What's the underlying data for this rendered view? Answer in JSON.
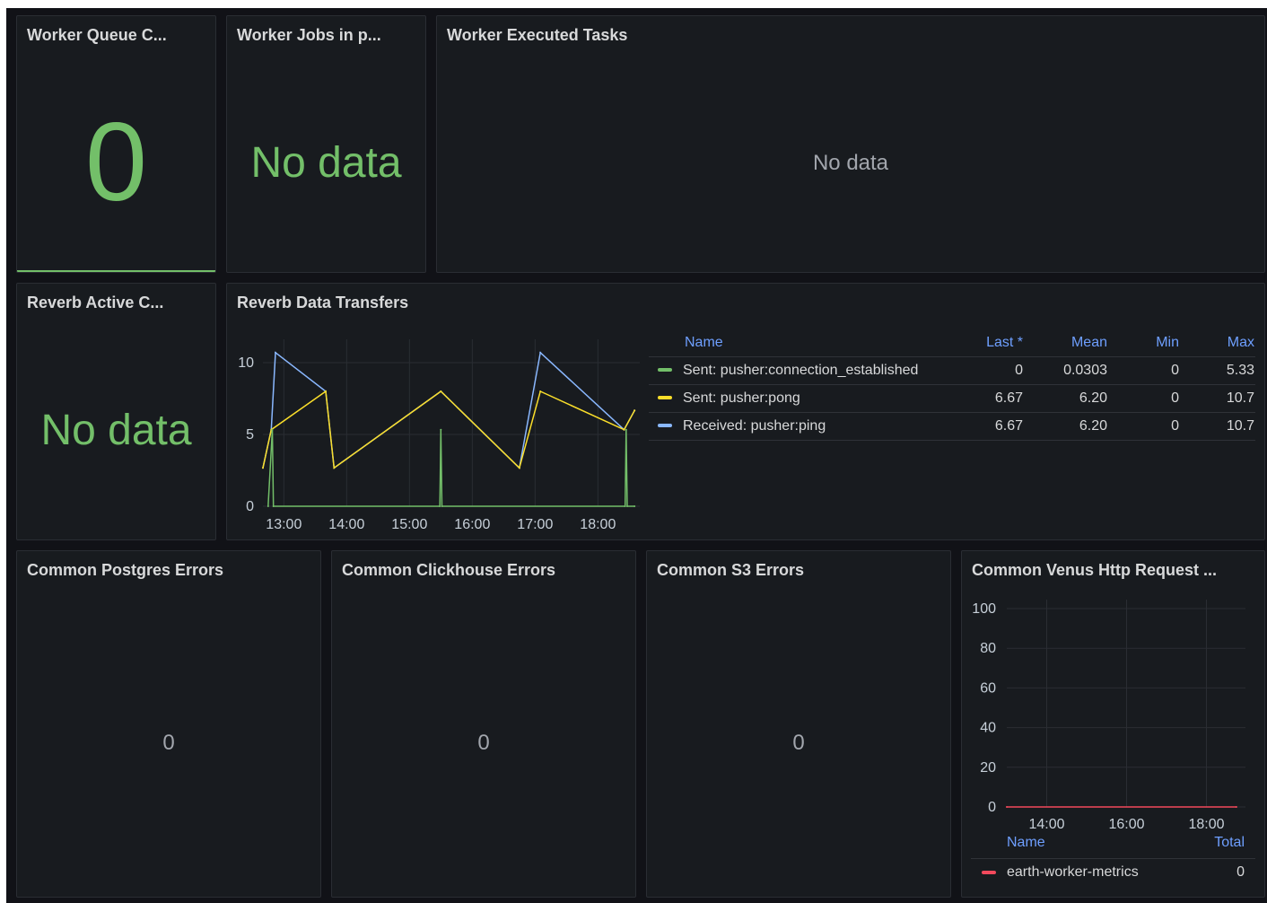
{
  "panels": {
    "worker_queue": {
      "title": "Worker Queue C...",
      "value": "0"
    },
    "worker_jobs": {
      "title": "Worker Jobs in p...",
      "value": "No data"
    },
    "worker_executed": {
      "title": "Worker Executed Tasks",
      "value": "No data"
    },
    "reverb_active": {
      "title": "Reverb Active C...",
      "value": "No data"
    },
    "reverb_transfers": {
      "title": "Reverb Data Transfers",
      "legend": {
        "headers": [
          "Name",
          "Last *",
          "Mean",
          "Min",
          "Max"
        ],
        "rows": [
          {
            "name": "Sent: pusher:connection_established",
            "color": "#73bf69",
            "last": "0",
            "mean": "0.0303",
            "min": "0",
            "max": "5.33"
          },
          {
            "name": "Sent: pusher:pong",
            "color": "#fade2a",
            "last": "6.67",
            "mean": "6.20",
            "min": "0",
            "max": "10.7"
          },
          {
            "name": "Received: pusher:ping",
            "color": "#8ab8ff",
            "last": "6.67",
            "mean": "6.20",
            "min": "0",
            "max": "10.7"
          }
        ]
      }
    },
    "postgres_errors": {
      "title": "Common Postgres Errors",
      "value": "0"
    },
    "clickhouse_errors": {
      "title": "Common Clickhouse Errors",
      "value": "0"
    },
    "s3_errors": {
      "title": "Common S3 Errors",
      "value": "0"
    },
    "venus_http": {
      "title": "Common Venus Http Request ...",
      "legend": {
        "name_header": "Name",
        "total_header": "Total",
        "row": {
          "name": "earth-worker-metrics",
          "color": "#f2495c",
          "total": "0"
        }
      }
    }
  },
  "chart_data": [
    {
      "type": "line",
      "xlabel": "",
      "ylabel": "",
      "x_ticks": [
        "13:00",
        "14:00",
        "15:00",
        "16:00",
        "17:00",
        "18:00"
      ],
      "y_ticks": [
        "0",
        "5",
        "10"
      ],
      "ylim": [
        0,
        11
      ],
      "grid": true,
      "legend_placement": "right",
      "series": [
        {
          "name": "Sent: pusher:connection_established",
          "color": "#73bf69",
          "points": [
            [
              "12:45",
              0
            ],
            [
              "12:49",
              5.33
            ],
            [
              "12:50",
              0
            ],
            [
              "15:29",
              0
            ],
            [
              "15:30",
              5.33
            ],
            [
              "15:31",
              0
            ],
            [
              "18:26",
              0
            ],
            [
              "18:27",
              5.33
            ],
            [
              "18:28",
              0
            ],
            [
              "18:35",
              0
            ]
          ]
        },
        {
          "name": "Sent: pusher:pong",
          "color": "#fade2a",
          "points": [
            [
              "12:40",
              2.67
            ],
            [
              "12:48",
              5.33
            ],
            [
              "13:40",
              8
            ],
            [
              "13:48",
              2.67
            ],
            [
              "15:30",
              8
            ],
            [
              "16:45",
              2.67
            ],
            [
              "17:05",
              8
            ],
            [
              "18:25",
              5.33
            ],
            [
              "18:35",
              6.67
            ]
          ]
        },
        {
          "name": "Received: pusher:ping",
          "color": "#8ab8ff",
          "points": [
            [
              "12:40",
              2.67
            ],
            [
              "12:48",
              5.33
            ],
            [
              "12:52",
              10.7
            ],
            [
              "13:40",
              8
            ],
            [
              "13:48",
              2.67
            ],
            [
              "15:30",
              8
            ],
            [
              "16:45",
              2.67
            ],
            [
              "17:05",
              10.7
            ],
            [
              "18:25",
              5.33
            ],
            [
              "18:35",
              6.67
            ]
          ]
        }
      ]
    },
    {
      "type": "line",
      "xlabel": "",
      "ylabel": "",
      "x_ticks": [
        "14:00",
        "16:00",
        "18:00"
      ],
      "y_ticks": [
        "0",
        "20",
        "40",
        "60",
        "80",
        "100"
      ],
      "ylim": [
        0,
        100
      ],
      "grid": true,
      "legend_placement": "bottom",
      "series": [
        {
          "name": "earth-worker-metrics",
          "color": "#f2495c",
          "points": [
            [
              "13:00",
              0
            ],
            [
              "18:45",
              0
            ]
          ]
        }
      ]
    }
  ]
}
